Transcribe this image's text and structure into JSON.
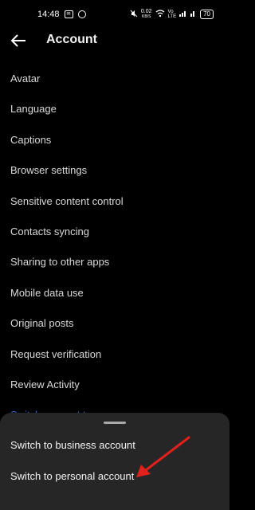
{
  "status_bar": {
    "time": "14:48",
    "net_speed_value": "0.02",
    "net_speed_unit": "KB/S",
    "battery": "70"
  },
  "header": {
    "title": "Account"
  },
  "menu": {
    "items": [
      {
        "label": "Avatar"
      },
      {
        "label": "Language"
      },
      {
        "label": "Captions"
      },
      {
        "label": "Browser settings"
      },
      {
        "label": "Sensitive content control"
      },
      {
        "label": "Contacts syncing"
      },
      {
        "label": "Sharing to other apps"
      },
      {
        "label": "Mobile data use"
      },
      {
        "label": "Original posts"
      },
      {
        "label": "Request verification"
      },
      {
        "label": "Review Activity"
      }
    ],
    "partial_item": "Switch account type"
  },
  "bottom_sheet": {
    "option_business": "Switch to business account",
    "option_personal": "Switch to personal account"
  },
  "colors": {
    "background": "#000000",
    "sheet_background": "#262626",
    "annotation_arrow": "#e0201b",
    "link_blue": "#2f6fd6"
  },
  "icons": [
    "back-arrow-icon",
    "annotation-arrow-icon"
  ]
}
